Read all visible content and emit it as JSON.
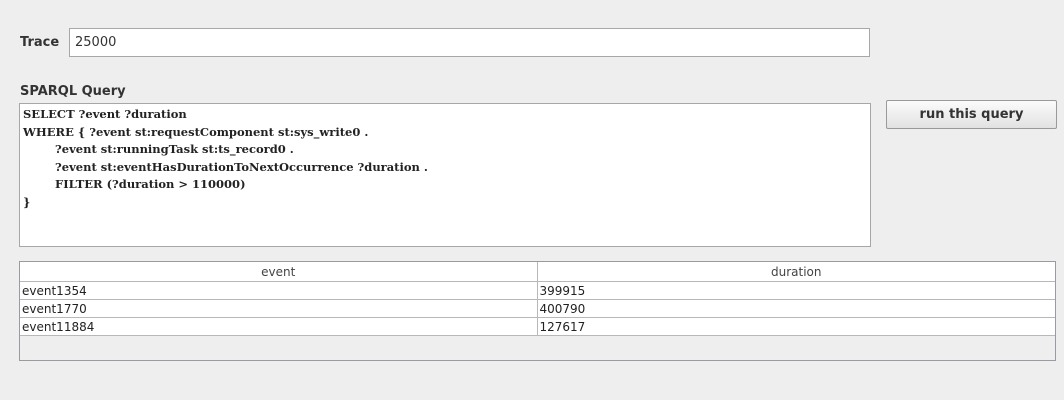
{
  "trace": {
    "label": "Trace",
    "value": "25000"
  },
  "query": {
    "label": "SPARQL Query",
    "text": "SELECT ?event ?duration\nWHERE { ?event st:requestComponent st:sys_write0 .\n        ?event st:runningTask st:ts_record0 .\n        ?event st:eventHasDurationToNextOccurrence ?duration .\n        FILTER (?duration > 110000)\n}",
    "run_label": "run this query"
  },
  "results": {
    "columns": [
      "event",
      "duration"
    ],
    "rows": [
      [
        "event1354",
        "399915"
      ],
      [
        "event1770",
        "400790"
      ],
      [
        "event11884",
        "127617"
      ]
    ]
  }
}
